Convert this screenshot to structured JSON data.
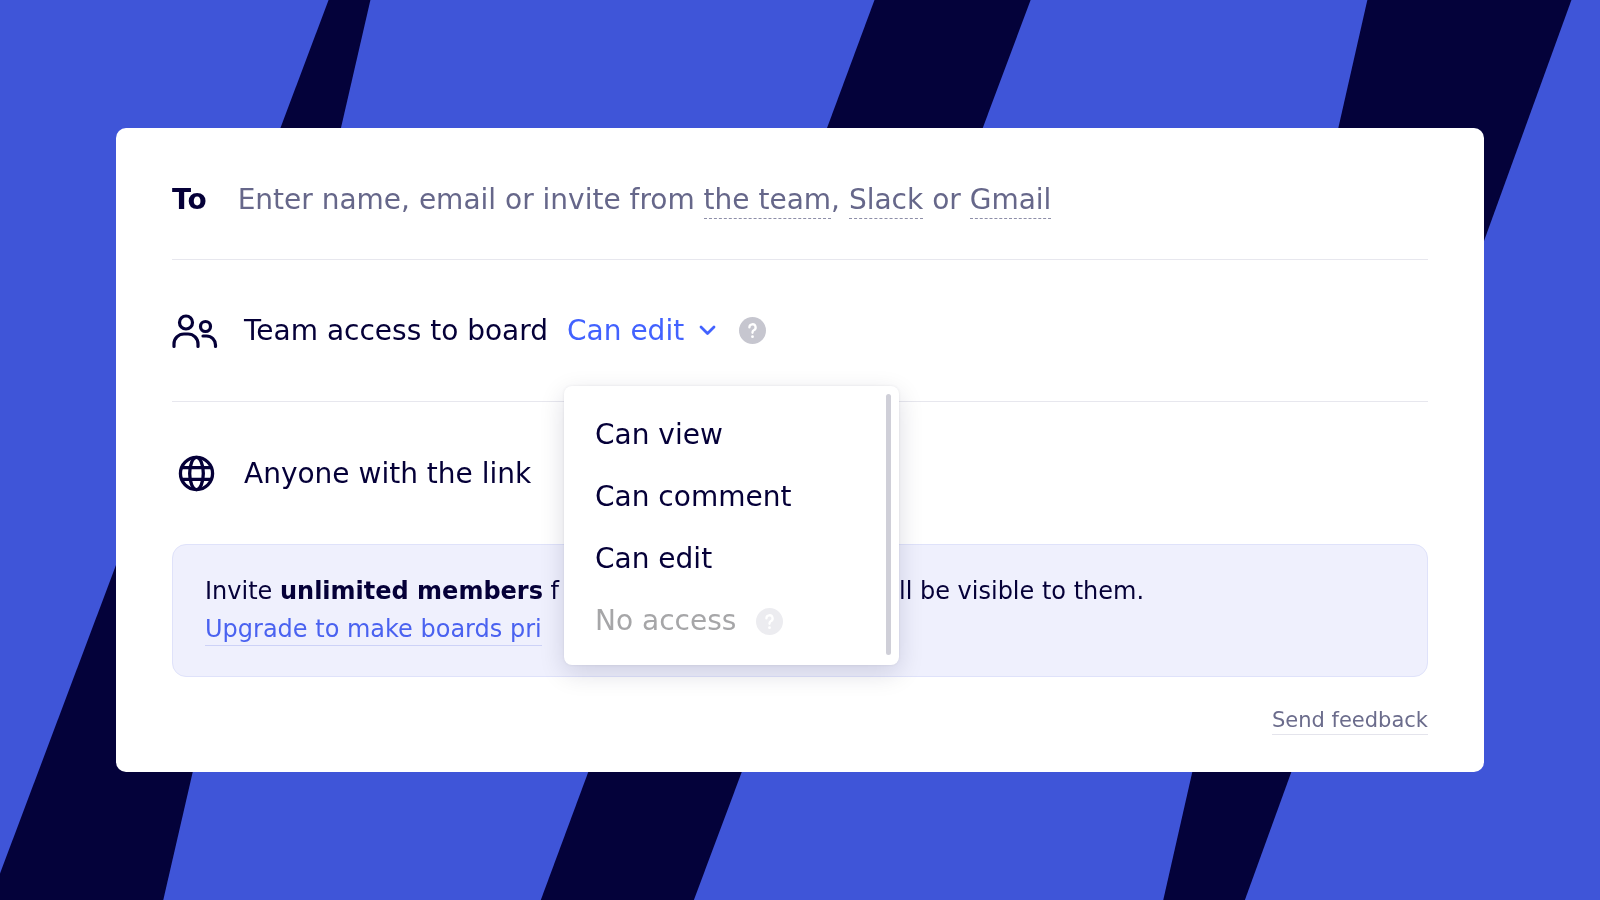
{
  "invite": {
    "label": "To",
    "prompt": [
      {
        "kind": "plain",
        "text": "Enter name, email or invite from "
      },
      {
        "kind": "link",
        "text": "the team"
      },
      {
        "kind": "plain",
        "text": ", "
      },
      {
        "kind": "link",
        "text": "Slack"
      },
      {
        "kind": "plain",
        "text": " or "
      },
      {
        "kind": "link",
        "text": "Gmail"
      }
    ]
  },
  "team_access": {
    "label": "Team access to board",
    "value": "Can edit",
    "expanded": true,
    "options": [
      {
        "label": "Can view",
        "disabled": false,
        "help_icon": false
      },
      {
        "label": "Can comment",
        "disabled": false,
        "help_icon": false
      },
      {
        "label": "Can edit",
        "disabled": false,
        "help_icon": false
      },
      {
        "label": "No access",
        "disabled": true,
        "help_icon": true
      }
    ]
  },
  "link_access": {
    "label": "Anyone with the link"
  },
  "notice": {
    "text_before": "Invite **unlimited members** f",
    "text_after": "ll be visible to them.",
    "link": "Upgrade to make boards pri"
  },
  "feedback_link": "Send feedback"
}
